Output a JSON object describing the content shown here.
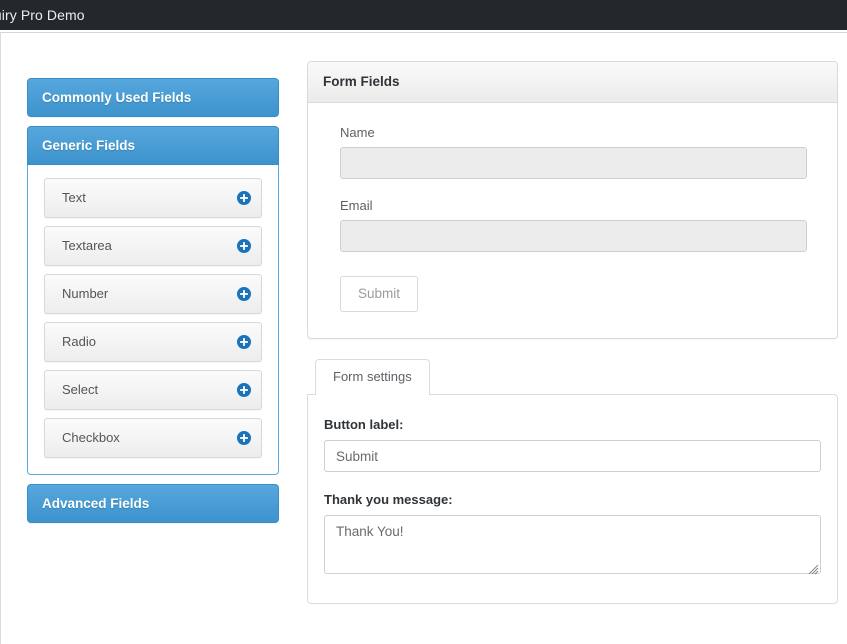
{
  "adminbar": {
    "title": "quiry Pro Demo"
  },
  "sidebar": {
    "panels": [
      {
        "title": "Commonly Used Fields",
        "open": false,
        "items": []
      },
      {
        "title": "Generic Fields",
        "open": true,
        "items": [
          {
            "label": "Text",
            "icon": "plus-circle-icon"
          },
          {
            "label": "Textarea",
            "icon": "plus-circle-icon"
          },
          {
            "label": "Number",
            "icon": "plus-circle-icon"
          },
          {
            "label": "Radio",
            "icon": "plus-circle-icon"
          },
          {
            "label": "Select",
            "icon": "plus-circle-icon"
          },
          {
            "label": "Checkbox",
            "icon": "plus-circle-icon"
          }
        ]
      },
      {
        "title": "Advanced Fields",
        "open": false,
        "items": []
      }
    ]
  },
  "form_fields_card": {
    "header": "Form Fields",
    "fields": [
      {
        "label": "Name",
        "value": "",
        "placeholder": ""
      },
      {
        "label": "Email",
        "value": "",
        "placeholder": ""
      }
    ],
    "submit_label": "Submit"
  },
  "settings_card": {
    "tabs": [
      {
        "label": "Form settings",
        "active": true
      }
    ],
    "button_label_caption": "Button label:",
    "button_label_value": "Submit",
    "thank_you_caption": "Thank you message:",
    "thank_you_value": "Thank You!"
  },
  "colors": {
    "adminbar_bg": "#23282d",
    "panel_blue_top": "#56a7dd",
    "panel_blue_bottom": "#3d93cd",
    "panel_border": "#3a8ec8",
    "icon_blue": "#1b74ba",
    "input_disabled_bg": "#ececec"
  }
}
